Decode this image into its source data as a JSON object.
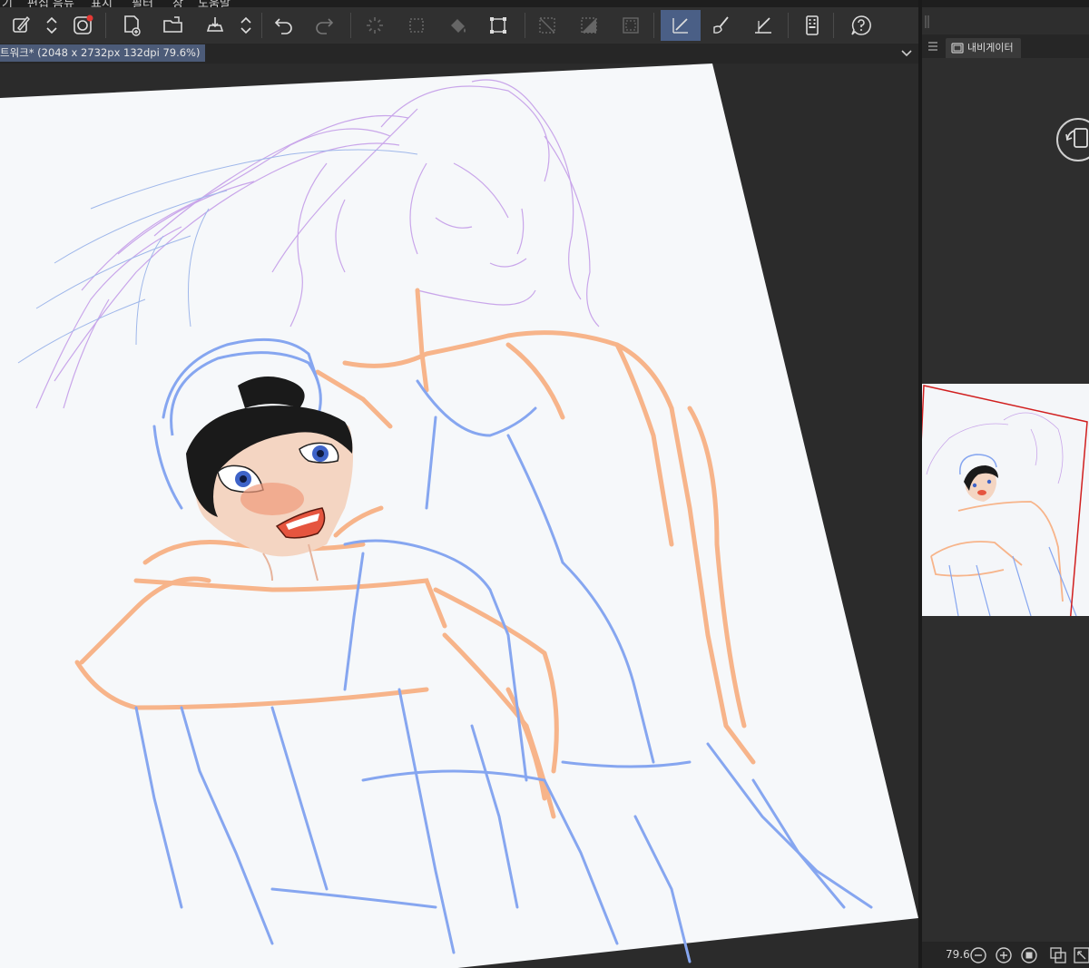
{
  "menubar": {
    "items": [
      "기",
      "편집 음뉴",
      "표시",
      "필터",
      "창",
      "도움말"
    ]
  },
  "toolbar": {
    "buttons": [
      {
        "name": "edit-icon",
        "active": false
      },
      {
        "name": "updown-icon",
        "active": false
      },
      {
        "name": "companion-icon",
        "active": false
      },
      {
        "name": "new-file-icon",
        "active": false
      },
      {
        "name": "open-folder-icon",
        "active": false
      },
      {
        "name": "save-icon",
        "active": false
      },
      {
        "name": "updown-icon",
        "active": false
      },
      {
        "name": "undo-icon",
        "active": false
      },
      {
        "name": "redo-icon",
        "active": false
      },
      {
        "name": "loading-icon",
        "active": false
      },
      {
        "name": "select-dots-icon",
        "active": false
      },
      {
        "name": "fill-icon",
        "active": false
      },
      {
        "name": "transform-icon",
        "active": false
      },
      {
        "name": "deselect-icon",
        "active": false
      },
      {
        "name": "invert-selection-icon",
        "active": false
      },
      {
        "name": "selection-border-icon",
        "active": false
      },
      {
        "name": "ruler-icon",
        "active": true
      },
      {
        "name": "brush-icon",
        "active": false
      },
      {
        "name": "ruler-pen-icon",
        "active": false
      },
      {
        "name": "device-icon",
        "active": false
      },
      {
        "name": "help-icon",
        "active": false
      }
    ]
  },
  "document_tab": {
    "label": "트워크* (2048 x 2732px 132dpi 79.6%)"
  },
  "panel": {
    "navigator_tab": "내비게이터",
    "zoom": "79.6"
  },
  "colors": {
    "canvas_paper": "#f6f8fa",
    "sketch_orange": "#f7b48a",
    "sketch_blue": "#86a6f0",
    "sketch_purple": "#c9a6ea",
    "active_tool": "#4a5f86",
    "navigator_frame": "#d11f1f"
  }
}
